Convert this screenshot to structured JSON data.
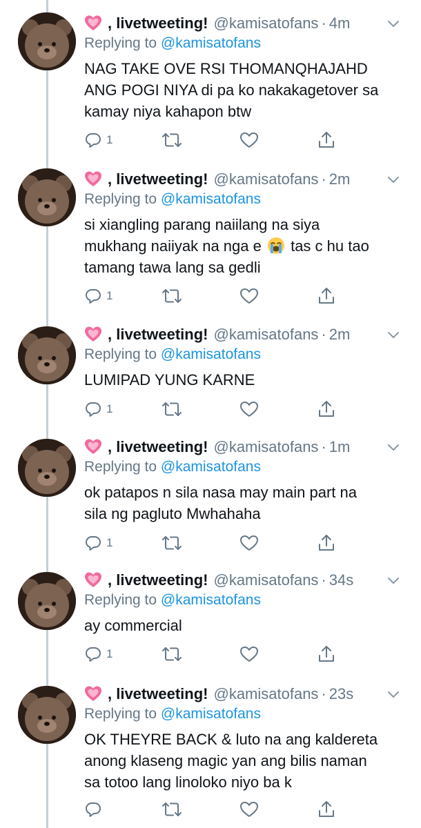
{
  "tweets": [
    {
      "display_name": ", livetweeting!",
      "handle": "@kamisatofans",
      "separator": "·",
      "time": "4m",
      "replying_prefix": "Replying to",
      "replying_to": "@kamisatofans",
      "text_lines": [
        "NAG TAKE OVE RSI THOMANQHAJAHD",
        "ANG POGI NIYA di pa ko nakakagetover sa",
        "kamay niya kahapon btw"
      ],
      "reply_count": "1"
    },
    {
      "display_name": ", livetweeting!",
      "handle": "@kamisatofans",
      "separator": "·",
      "time": "2m",
      "replying_prefix": "Replying to",
      "replying_to": "@kamisatofans",
      "text_line1": "si xiangling parang naiilang na siya",
      "text_line2_before": "mukhang naiiyak na nga e ",
      "text_line2_after": " tas c hu tao",
      "text_line3": "tamang tawa lang sa gedli",
      "inline_emoji": "loudly-crying-face",
      "reply_count": "1"
    },
    {
      "display_name": ", livetweeting!",
      "handle": "@kamisatofans",
      "separator": "·",
      "time": "2m",
      "replying_prefix": "Replying to",
      "replying_to": "@kamisatofans",
      "text_lines": [
        "LUMIPAD YUNG KARNE"
      ],
      "reply_count": "1"
    },
    {
      "display_name": ", livetweeting!",
      "handle": "@kamisatofans",
      "separator": "·",
      "time": "1m",
      "replying_prefix": "Replying to",
      "replying_to": "@kamisatofans",
      "text_lines": [
        "ok patapos n sila nasa may main part na",
        "sila ng pagluto Mwhahaha"
      ],
      "reply_count": "1"
    },
    {
      "display_name": ", livetweeting!",
      "handle": "@kamisatofans",
      "separator": "·",
      "time": "34s",
      "replying_prefix": "Replying to",
      "replying_to": "@kamisatofans",
      "text_lines": [
        "ay commercial"
      ],
      "reply_count": "1"
    },
    {
      "display_name": ", livetweeting!",
      "handle": "@kamisatofans",
      "separator": "·",
      "time": "23s",
      "replying_prefix": "Replying to",
      "replying_to": "@kamisatofans",
      "text_lines": [
        "OK THEYRE BACK & luto na ang kaldereta",
        "anong klaseng magic yan ang bilis naman",
        "sa totoo lang linoloko niyo ba k"
      ],
      "reply_count": ""
    }
  ],
  "icons": {
    "name_emoji": "growing-heart-emoji",
    "avatar": "brown-bear-plush-avatar",
    "actions": [
      "reply-icon",
      "retweet-icon",
      "like-icon",
      "share-icon"
    ],
    "menu": "chevron-down-icon"
  },
  "colors": {
    "secondary_text": "#657786",
    "link": "#1b95e0",
    "primary_text": "#0f1419",
    "thread_line": "#c4cfd6"
  }
}
